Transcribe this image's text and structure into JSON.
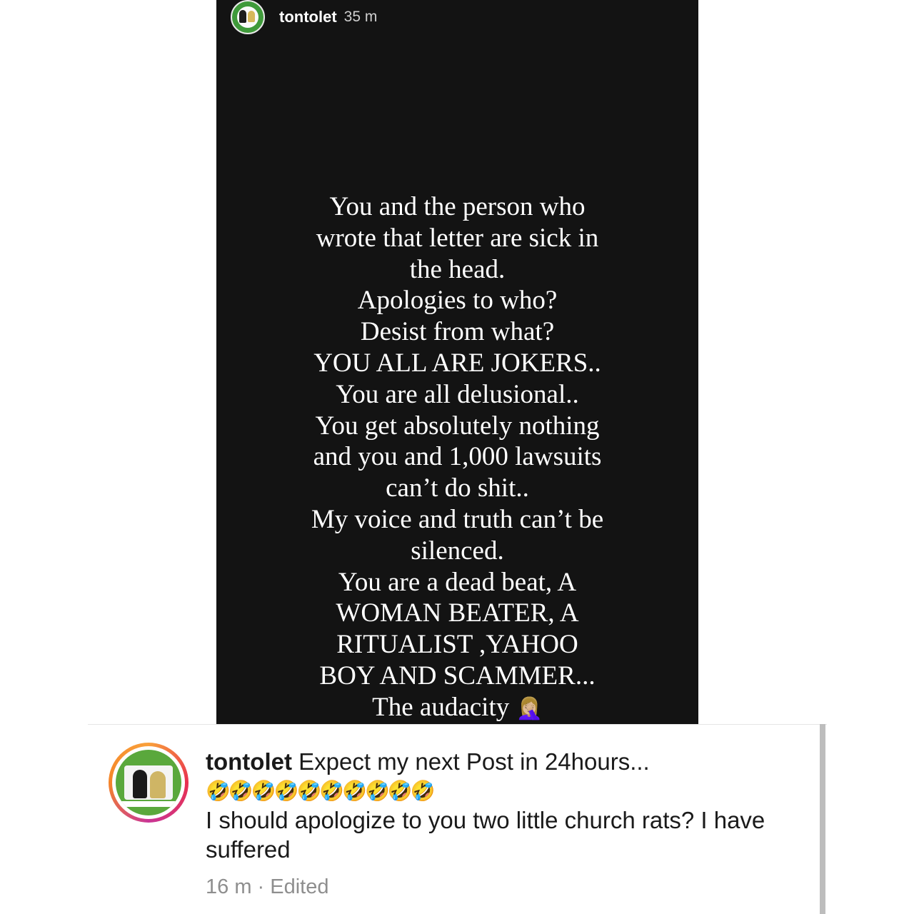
{
  "story": {
    "username": "tontolet",
    "time": "35 m",
    "text": "You and the person who\nwrote that letter are sick in\nthe head.\nApologies to who?\nDesist from what?\nYOU ALL ARE JOKERS..\nYou are all delusional..\nYou get absolutely nothing\nand you and 1,000 lawsuits\ncan’t do shit..\nMy voice and truth can’t be\nsilenced.\nYou are a dead beat, A\nWOMAN BEATER, A\nRITUALIST ,YAHOO\nBOY AND SCAMMER...\nThe audacity ",
    "emoji": "🤦🏼‍♀️"
  },
  "comment": {
    "username": "tontolet",
    "line1": "Expect my next Post in 24hours...",
    "emojis": "🤣🤣🤣🤣🤣🤣🤣🤣🤣🤣",
    "line3": "I should apologize to you two little church rats? I have suffered",
    "time": "16 m",
    "separator": " · ",
    "edited": "Edited"
  }
}
